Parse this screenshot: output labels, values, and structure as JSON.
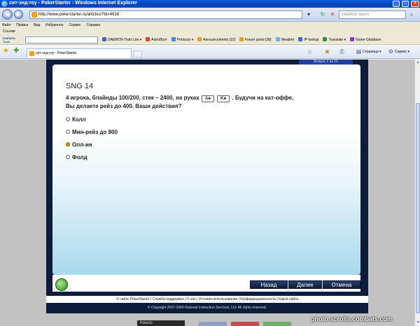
{
  "window": {
    "title": "сит-энд-гоу - PokerStarter - Windows Internet Explorer"
  },
  "address": {
    "url": "http://www.pokerstarter.ru/articles/?id=4616",
    "search_placeholder": "DAEMON Search"
  },
  "menu": [
    "Файл",
    "Правка",
    "Вид",
    "Избранное",
    "Сервис",
    "Справка"
  ],
  "links_label": "Ссылки",
  "toolbar": {
    "daemon_label": "DAEMON Tools",
    "items": [
      {
        "label": "DAEMON Tools Lite ▾",
        "color": "#3a6ad0"
      },
      {
        "label": "AstroBurn",
        "color": "#d04a2a"
      },
      {
        "label": "Products ▾",
        "color": "#4a8ad0"
      },
      {
        "label": "Announcements [15]",
        "color": "#e0a020"
      },
      {
        "label": "Forum posts [30]",
        "color": "#e0a020"
      },
      {
        "label": "Weather",
        "color": "#6ab0e0"
      },
      {
        "label": "IP-lookup",
        "color": "#3a6ad0"
      },
      {
        "label": "Translate ▾",
        "color": "#3a8a3a"
      },
      {
        "label": "Game Database",
        "color": "#8a3ad0"
      }
    ]
  },
  "tab": {
    "label": "сит-энд-гоу - PokerStarter"
  },
  "commands": {
    "page": "Страница ▾",
    "tools": "Сервис ▾"
  },
  "quiz": {
    "progress": "Вопрос 2 из 15",
    "title": "SNG 14",
    "question_part1": "4 игрока, блайнды 100/200, стек – 2400, на руках",
    "card1": "A♣",
    "card2": "K♣",
    "question_part2": ". Будучи на кат-оффе, Вы делаете рейз до 400. Ваши действия?",
    "options": [
      {
        "label": "Колл",
        "selected": false
      },
      {
        "label": "Мин-рейз до 800",
        "selected": false
      },
      {
        "label": "Олл-ин",
        "selected": true
      },
      {
        "label": "Фолд",
        "selected": false
      }
    ],
    "buttons": {
      "back": "Назад",
      "next": "Далее",
      "cancel": "Отмена"
    }
  },
  "footer": {
    "links": "© сайте PokerStarter | Служба поддержки | О нас | Условия использования | Конфиденциальность | Карта сайта",
    "copyright": "© Copyright 2007-2009 Rational Instruction Services, Ltd. All rights reserved."
  },
  "bottom_banner": "PokerSt",
  "watermark": "photo.scrolls.combats.com"
}
